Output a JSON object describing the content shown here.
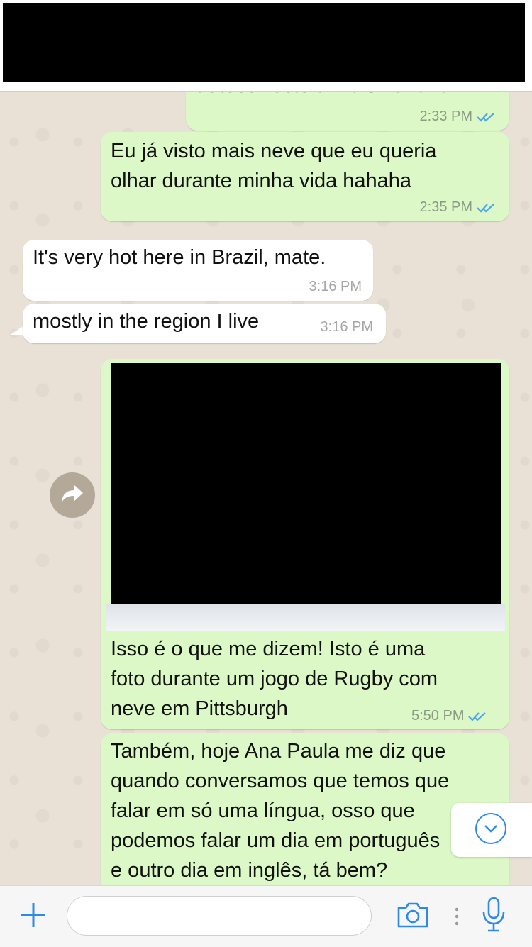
{
  "header": {
    "redacted": true
  },
  "messages": [
    {
      "id": "m0",
      "direction": "outgoing",
      "text": "autocorrecto a mais hahaha",
      "time": "2:33 PM",
      "status": "read"
    },
    {
      "id": "m1",
      "direction": "outgoing",
      "text": "Eu já visto mais neve que eu queria\nolhar durante minha vida hahaha",
      "time": "2:35 PM",
      "status": "read"
    },
    {
      "id": "m2",
      "direction": "incoming",
      "text": "It's very hot here in Brazil, mate.",
      "time": "3:16 PM"
    },
    {
      "id": "m3",
      "direction": "incoming",
      "text": "mostly in the region I live",
      "time": "3:16 PM"
    },
    {
      "id": "m4",
      "direction": "outgoing",
      "type": "image",
      "caption": "Isso é o que me dizem! Isto é uma\nfoto durante um jogo de Rugby com\nneve em Pittsburgh",
      "time": "5:50 PM",
      "status": "read"
    },
    {
      "id": "m5",
      "direction": "outgoing",
      "text": "Também, hoje Ana Paula me diz que\nquando conversamos que temos que\nfalar em só uma língua, osso que\npodemos falar um dia em português\ne outro dia em inglês, tá bem?"
    }
  ],
  "icons": {
    "forward": "forward-arrow-icon",
    "scroll_down": "chevron-down-icon",
    "attach": "plus-icon",
    "camera": "camera-icon",
    "mic": "microphone-icon",
    "ticks": "double-check-icon"
  },
  "colors": {
    "outgoing_bubble": "#dcf8c6",
    "incoming_bubble": "#ffffff",
    "accent": "#2f8ae6",
    "read_ticks": "#4fa6e8"
  },
  "composer": {
    "placeholder": ""
  }
}
